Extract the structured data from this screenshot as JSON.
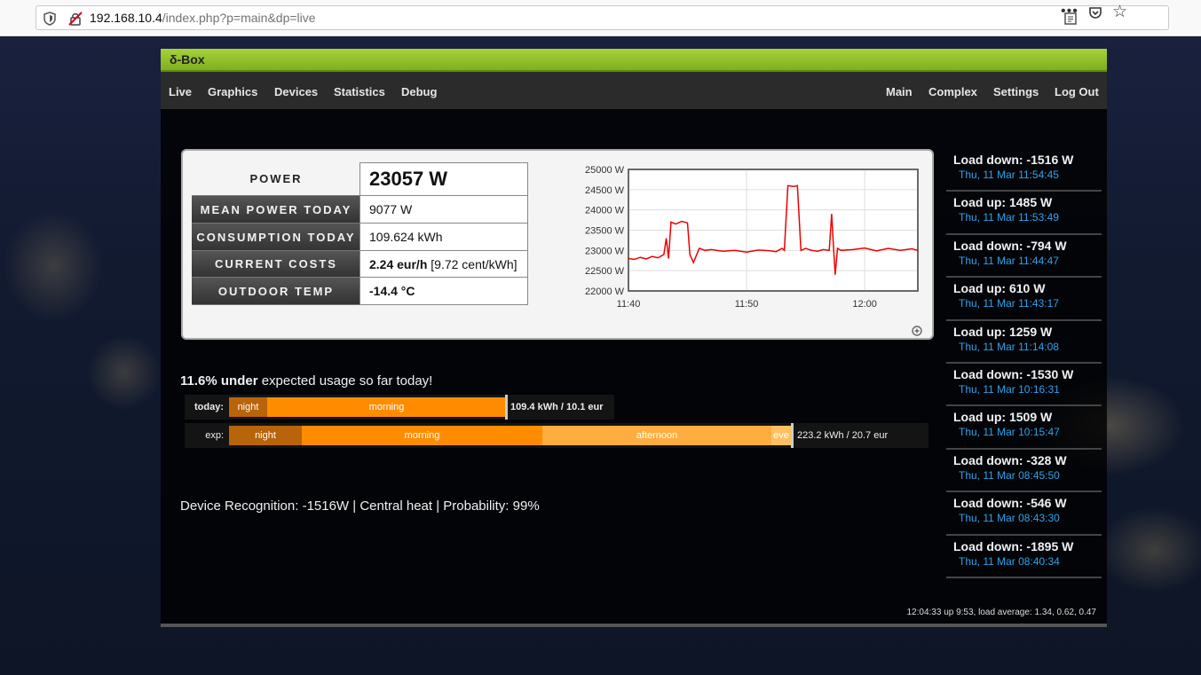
{
  "browser": {
    "url_host": "192.168.10.4",
    "url_path": "/index.php?p=main&dp=live"
  },
  "app": {
    "title": "δ-Box"
  },
  "nav": {
    "left": [
      {
        "label": "Live",
        "active": true
      },
      {
        "label": "Graphics",
        "active": false
      },
      {
        "label": "Devices",
        "active": false
      },
      {
        "label": "Statistics",
        "active": false
      },
      {
        "label": "Debug",
        "active": false
      }
    ],
    "right": [
      {
        "label": "Main",
        "active": true
      },
      {
        "label": "Complex",
        "active": false
      },
      {
        "label": "Settings",
        "active": false
      },
      {
        "label": "Log Out",
        "active": false
      }
    ]
  },
  "stats": [
    {
      "label": "POWER",
      "value": "23057 W"
    },
    {
      "label": "MEAN POWER TODAY",
      "value": "9077 W"
    },
    {
      "label": "CONSUMPTION TODAY",
      "value": "109.624 kWh"
    },
    {
      "label": "CURRENT COSTS",
      "value_bold": "2.24 eur/h",
      "value_rest": " [9.72 cent/kWh]"
    },
    {
      "label": "OUTDOOR TEMP",
      "value": "-14.4 °C"
    }
  ],
  "chart_data": {
    "type": "line",
    "color": "#ee0000",
    "y_ticks": [
      "25000 W",
      "24500 W",
      "24000 W",
      "23500 W",
      "23000 W",
      "22500 W",
      "22000 W"
    ],
    "ylim": [
      22000,
      25000
    ],
    "x_ticks": [
      "11:40",
      "11:50",
      "12:00"
    ],
    "x_tick_minutes": [
      0,
      10,
      20
    ],
    "xlim_minutes": [
      0,
      24.5
    ],
    "series": [
      {
        "x": [
          0,
          0.5,
          1,
          1.5,
          2,
          2.5,
          3,
          3.2,
          3.4,
          3.6,
          4,
          4.5,
          5,
          5.2,
          5.5,
          6,
          6.5,
          7,
          8,
          9,
          10,
          11,
          12,
          12.5,
          13,
          13.2,
          13.5,
          14,
          14.3,
          14.6,
          15,
          15.5,
          16,
          16.5,
          17,
          17.2,
          17.4,
          17.5,
          17.7,
          18,
          19,
          20,
          21,
          22,
          23,
          24,
          24.5
        ],
        "y": [
          22800,
          22780,
          22830,
          22790,
          22850,
          22820,
          22900,
          23300,
          22800,
          23700,
          23650,
          23720,
          23680,
          22900,
          22700,
          23050,
          23000,
          23020,
          22980,
          23000,
          22960,
          23010,
          22990,
          22970,
          23050,
          23000,
          24600,
          24580,
          24600,
          23000,
          23050,
          23000,
          22980,
          23020,
          23000,
          23900,
          22900,
          22400,
          23050,
          23000,
          23020,
          23060,
          22990,
          23050,
          23000,
          23040,
          23000
        ]
      }
    ]
  },
  "usage": {
    "headline_bold": "11.6% under",
    "headline_rest": " expected usage so far today!",
    "today_label": "today:",
    "today_segments": [
      {
        "name": "night",
        "class": "seg-night",
        "width": 43
      },
      {
        "name": "morning",
        "class": "seg-morning",
        "width": 269
      }
    ],
    "today_total": "109.4 kWh / 10.1 eur",
    "exp_label": "exp:",
    "exp_segments": [
      {
        "name": "night",
        "class": "seg-night",
        "width": 82
      },
      {
        "name": "morning",
        "class": "seg-morning",
        "width": 271
      },
      {
        "name": "afternoon",
        "class": "seg-afternoon",
        "width": 258
      },
      {
        "name": "eve",
        "class": "seg-eve",
        "width": 22
      }
    ],
    "exp_total": "223.2 kWh / 20.7 eur"
  },
  "device_recognition": "Device Recognition: -1516W | Central heat | Probability: 99%",
  "status_line": "12:04:33 up 9:53, load average: 1.34, 0.62, 0.47",
  "events": [
    {
      "title": "Load down: -1516 W",
      "time": "Thu, 11 Mar 11:54:45"
    },
    {
      "title": "Load up: 1485 W",
      "time": "Thu, 11 Mar 11:53:49"
    },
    {
      "title": "Load down: -794 W",
      "time": "Thu, 11 Mar 11:44:47"
    },
    {
      "title": "Load up: 610 W",
      "time": "Thu, 11 Mar 11:43:17"
    },
    {
      "title": "Load up: 1259 W",
      "time": "Thu, 11 Mar 11:14:08"
    },
    {
      "title": "Load down: -1530 W",
      "time": "Thu, 11 Mar 10:16:31"
    },
    {
      "title": "Load up: 1509 W",
      "time": "Thu, 11 Mar 10:15:47"
    },
    {
      "title": "Load down: -328 W",
      "time": "Thu, 11 Mar 08:45:50"
    },
    {
      "title": "Load down: -546 W",
      "time": "Thu, 11 Mar 08:43:30"
    },
    {
      "title": "Load down: -1895 W",
      "time": "Thu, 11 Mar 08:40:34"
    }
  ]
}
